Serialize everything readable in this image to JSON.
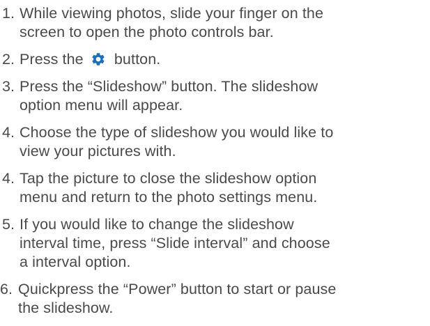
{
  "steps": [
    {
      "num": "1.",
      "lines": [
        "While viewing photos, slide your finger on the",
        "screen to open the photo controls bar."
      ]
    },
    {
      "num": "2.",
      "before": "Press the",
      "after": "button.",
      "icon": "gear-icon",
      "icon_color": "#1f6fb8"
    },
    {
      "num": "3.",
      "lines": [
        "Press the “Slideshow” button.  The slideshow",
        "option menu will appear."
      ]
    },
    {
      "num": "4.",
      "lines": [
        "Choose the type of slideshow you would like to",
        "view your pictures with."
      ]
    },
    {
      "num": "4.",
      "lines": [
        "Tap the picture to close the slideshow option",
        "menu and return to the photo settings menu."
      ]
    },
    {
      "num": "5.",
      "lines": [
        "If you would like to change the slideshow",
        "interval time, press “Slide interval” and choose",
        "a interval option."
      ]
    },
    {
      "num": "6.",
      "lines": [
        "Quickpress the “Power” button to start or pause",
        "the slideshow."
      ]
    }
  ]
}
